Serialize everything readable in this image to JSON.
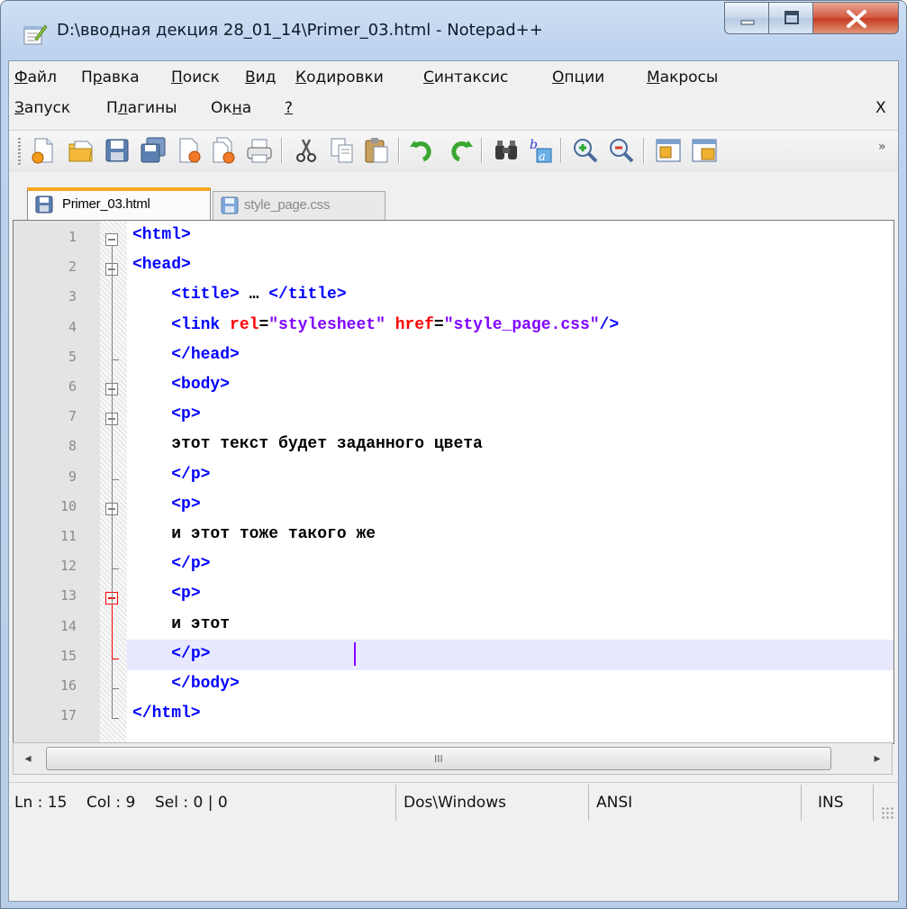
{
  "window": {
    "title": "D:\\вводная декция 28_01_14\\Primer_03.html - Notepad++"
  },
  "menu": {
    "row1": [
      "Файл",
      "Правка",
      "Поиск",
      "Вид",
      "Кодировки",
      "Синтаксис",
      "Опции",
      "Макросы"
    ],
    "row2": [
      "Запуск",
      "Плагины",
      "Окна",
      "?"
    ],
    "close_doc": "X"
  },
  "toolbar": {
    "icons": [
      "new-file-icon",
      "open-file-icon",
      "save-icon",
      "save-all-icon",
      "close-icon",
      "close-all-icon",
      "print-icon",
      "cut-icon",
      "copy-icon",
      "paste-icon",
      "undo-icon",
      "redo-icon",
      "find-icon",
      "replace-icon",
      "zoom-in-icon",
      "zoom-out-icon",
      "sync-vertical-icon",
      "sync-horizontal-icon"
    ],
    "more": "»"
  },
  "tabs": [
    {
      "label": "Primer_03.html",
      "active": true
    },
    {
      "label": "style_page.css",
      "active": false
    }
  ],
  "editor": {
    "line_numbers": [
      "1",
      "2",
      "3",
      "4",
      "5",
      "6",
      "7",
      "8",
      "9",
      "10",
      "11",
      "12",
      "13",
      "14",
      "15",
      "16",
      "17"
    ],
    "current_line": 15,
    "lines": [
      [
        {
          "t": "<html>",
          "c": "tag"
        }
      ],
      [
        {
          "t": "<head>",
          "c": "tag"
        }
      ],
      [
        {
          "t": "    ",
          "c": "plain"
        },
        {
          "t": "<title>",
          "c": "tag"
        },
        {
          "t": " … ",
          "c": "plain"
        },
        {
          "t": "</title>",
          "c": "tag"
        }
      ],
      [
        {
          "t": "    ",
          "c": "plain"
        },
        {
          "t": "<link ",
          "c": "tag"
        },
        {
          "t": "rel",
          "c": "attr"
        },
        {
          "t": "=",
          "c": "plain"
        },
        {
          "t": "\"stylesheet\"",
          "c": "val"
        },
        {
          "t": " ",
          "c": "plain"
        },
        {
          "t": "href",
          "c": "attr"
        },
        {
          "t": "=",
          "c": "plain"
        },
        {
          "t": "\"style_page.css\"",
          "c": "val"
        },
        {
          "t": "/>",
          "c": "tag"
        }
      ],
      [
        {
          "t": "    ",
          "c": "plain"
        },
        {
          "t": "</head>",
          "c": "tag"
        }
      ],
      [
        {
          "t": "    ",
          "c": "plain"
        },
        {
          "t": "<body>",
          "c": "tag"
        }
      ],
      [
        {
          "t": "    ",
          "c": "plain"
        },
        {
          "t": "<p>",
          "c": "tag"
        }
      ],
      [
        {
          "t": "    этот текст будет заданного цвета",
          "c": "plain"
        }
      ],
      [
        {
          "t": "    ",
          "c": "plain"
        },
        {
          "t": "</p>",
          "c": "tag"
        }
      ],
      [
        {
          "t": "    ",
          "c": "plain"
        },
        {
          "t": "<p>",
          "c": "tag"
        }
      ],
      [
        {
          "t": "    и этот тоже такого же",
          "c": "plain"
        }
      ],
      [
        {
          "t": "    ",
          "c": "plain"
        },
        {
          "t": "</p>",
          "c": "tag"
        }
      ],
      [
        {
          "t": "    ",
          "c": "plain"
        },
        {
          "t": "<p>",
          "c": "tag"
        }
      ],
      [
        {
          "t": "    и этот",
          "c": "plain"
        }
      ],
      [
        {
          "t": "    ",
          "c": "plain"
        },
        {
          "t": "</p>",
          "c": "tag"
        }
      ],
      [
        {
          "t": "    ",
          "c": "plain"
        },
        {
          "t": "</body>",
          "c": "tag"
        }
      ],
      [
        {
          "t": "</html>",
          "c": "tag"
        }
      ]
    ]
  },
  "scrollbar": {
    "left": "◂",
    "right": "▸",
    "grip": "III"
  },
  "status": {
    "position": "Ln : 15    Col : 9    Sel : 0 | 0",
    "eol": "Dos\\Windows",
    "encoding": "ANSI",
    "mode": "INS"
  },
  "colors": {
    "tag": "#0000ff",
    "attr": "#ff0000",
    "value": "#8000ff",
    "current_line": "#e8e8ff",
    "tab_accent": "#f6a623"
  }
}
